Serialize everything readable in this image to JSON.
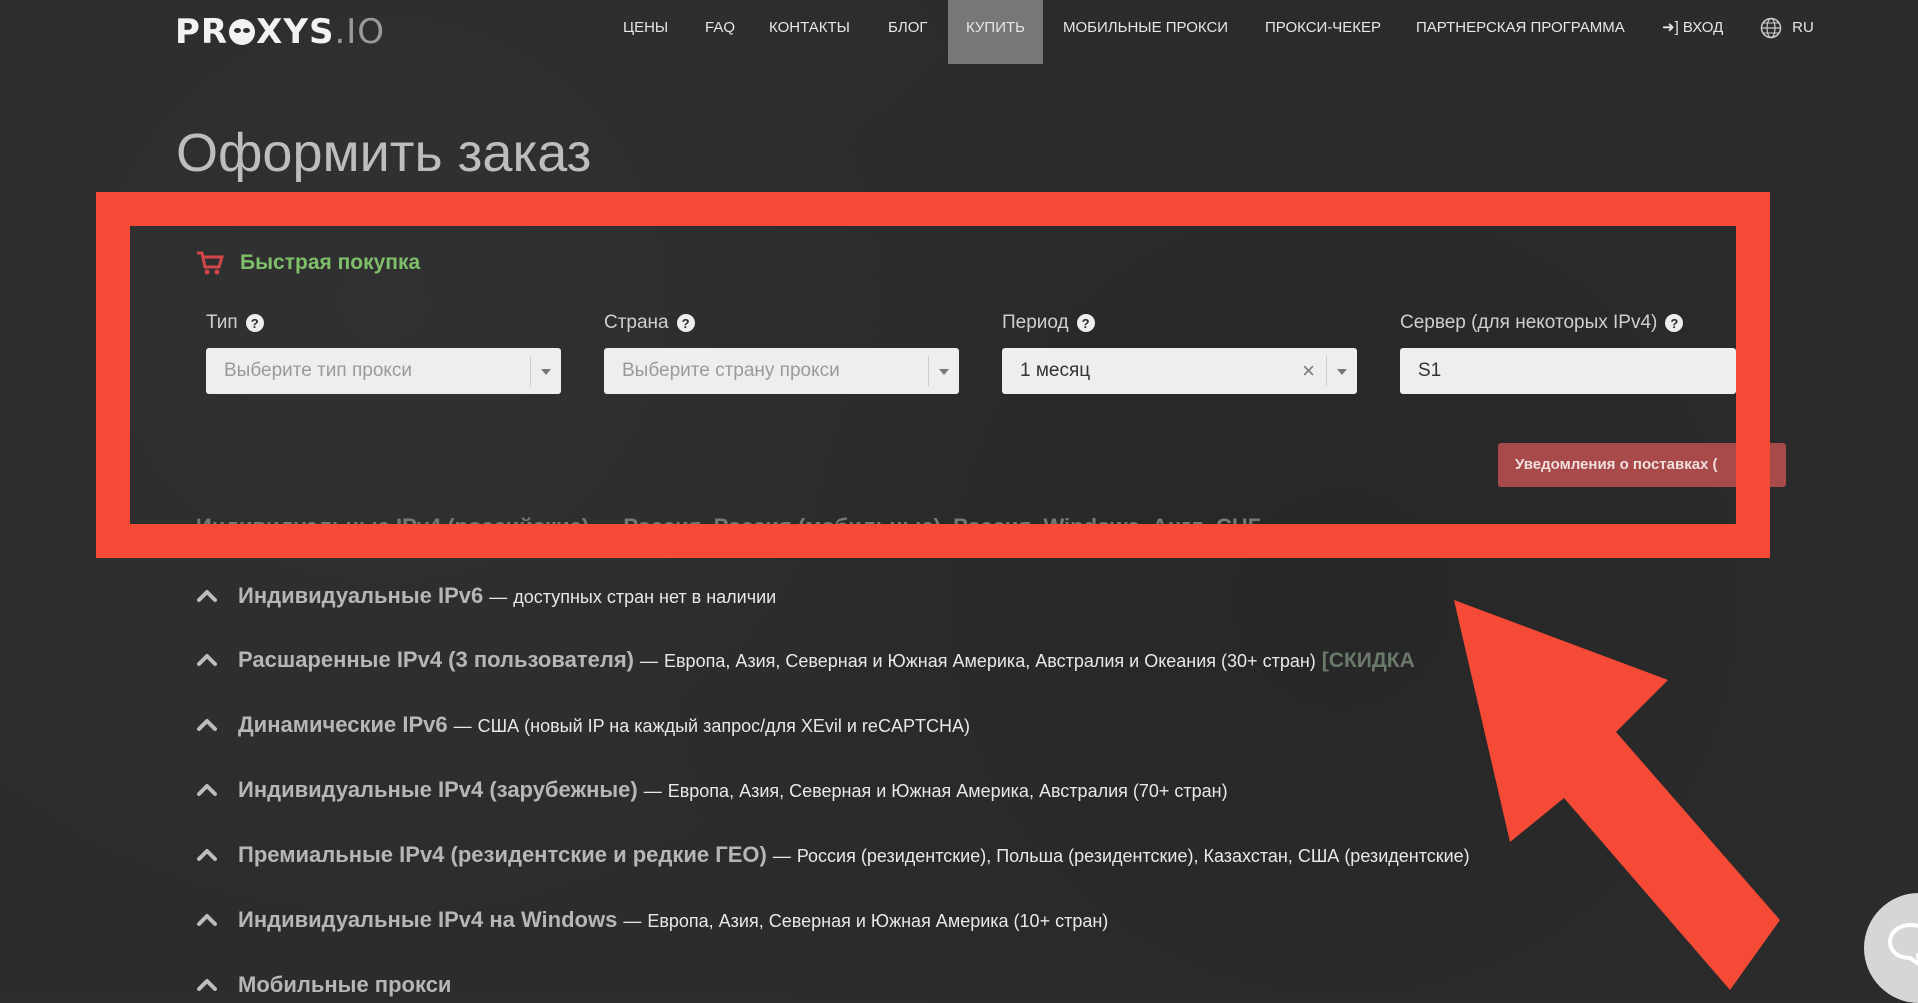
{
  "header": {
    "logo_strong": "PR",
    "logo_strong2": "XYS",
    "logo_light": ".IO",
    "nav": [
      "ЦЕНЫ",
      "FAQ",
      "КОНТАКТЫ",
      "БЛОГ",
      "КУПИТЬ",
      "МОБИЛЬНЫЕ ПРОКСИ",
      "ПРОКСИ-ЧЕКЕР",
      "ПАРТНЕРСКАЯ ПРОГРАММА"
    ],
    "login": "ВХОД",
    "lang": "RU"
  },
  "page_title": "Оформить заказ",
  "quick_buy": {
    "title": "Быстрая покупка",
    "fields": [
      {
        "label": "Тип",
        "placeholder": "Выберите тип прокси"
      },
      {
        "label": "Страна",
        "placeholder": "Выберите страну прокси"
      },
      {
        "label": "Период",
        "value": "1 месяц"
      },
      {
        "label": "Сервер (для некоторых IPv4)",
        "value": "S1"
      }
    ],
    "help_glyph": "?",
    "clear_glyph": "×",
    "notify_button": "Уведомления о поставках ("
  },
  "partial_row": "Индивидуальные IPv4 (российские) — Россия, Россия (мобильные), Россия, Windows, Англ, СНГ",
  "rows": [
    {
      "title": "Индивидуальные IPv6",
      "desc": "доступных стран нет в наличии"
    },
    {
      "title": "Расшаренные IPv4 (3 пользователя)",
      "desc": "Европа, Азия, Северная и Южная Америка, Австралия и Океания (30+ стран)",
      "badge": "[СКИДКА"
    },
    {
      "title": "Динамические IPv6",
      "desc": "США (новый IP на каждый запрос/для XEvil и reCAPTCHA)"
    },
    {
      "title": "Индивидуальные IPv4 (зарубежные)",
      "desc": "Европа, Азия, Северная и Южная Америка, Австралия (70+ стран)"
    },
    {
      "title": "Премиальные IPv4 (резидентские и редкие ГЕО)",
      "desc": "Россия (резидентские), Польша (резидентские), Казахстан, США (резидентские)"
    },
    {
      "title": "Индивидуальные IPv4 на Windows",
      "desc": "Европа, Азия, Северная и Южная Америка (10+ стран)"
    },
    {
      "title": "Мобильные прокси",
      "desc": ""
    }
  ],
  "dash": "—",
  "colors": {
    "accent_red": "#f44a36",
    "quick_title_green": "#7fbf6a",
    "notify_bg": "#a84a4a",
    "nav_active": "#777777"
  },
  "icons": [
    "cart-icon",
    "help-icon",
    "chevron-up-icon",
    "globe-icon",
    "login-icon",
    "chat-icon"
  ]
}
